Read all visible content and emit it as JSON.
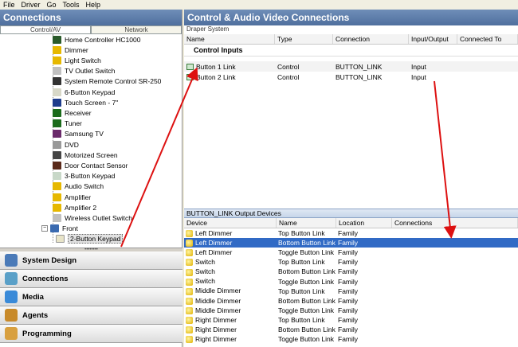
{
  "menu": [
    "File",
    "Driver",
    "Go",
    "Tools",
    "Help"
  ],
  "left": {
    "title": "Connections",
    "tabs": [
      "Control/AV",
      "Network"
    ],
    "tree": [
      {
        "label": "Home Controller HC1000",
        "color": "#2a5a2a"
      },
      {
        "label": "Dimmer",
        "color": "#e6b800"
      },
      {
        "label": "Light Switch",
        "color": "#e6b800"
      },
      {
        "label": "TV Outlet Switch",
        "color": "#c0c0c0"
      },
      {
        "label": "System Remote Control SR-250",
        "color": "#333333"
      },
      {
        "label": "6-Button Keypad",
        "color": "#d8d8c8"
      },
      {
        "label": "Touch Screen - 7\"",
        "color": "#1e3c8c"
      },
      {
        "label": "Receiver",
        "color": "#1b6b1b"
      },
      {
        "label": "Tuner",
        "color": "#1b6b1b"
      },
      {
        "label": "Samsung TV",
        "color": "#6a2a6a"
      },
      {
        "label": "DVD",
        "color": "#999999"
      },
      {
        "label": "Motorized Screen",
        "color": "#444444"
      },
      {
        "label": "Door Contact Sensor",
        "color": "#5a2a1a"
      },
      {
        "label": "3-Button Keypad",
        "color": "#c8d8c8"
      },
      {
        "label": "Audio Switch",
        "color": "#e6b800"
      },
      {
        "label": "Amplifier",
        "color": "#e6b800"
      },
      {
        "label": "Amplifier 2",
        "color": "#e6b800"
      },
      {
        "label": "Wireless Outlet Switch",
        "color": "#c0c0c0"
      }
    ],
    "front": "Front",
    "front_child": "2-Button Keypad",
    "nav": [
      {
        "label": "System Design",
        "color": "#4a7ab8"
      },
      {
        "label": "Connections",
        "color": "#5aa0c8"
      },
      {
        "label": "Media",
        "color": "#3a8ad8"
      },
      {
        "label": "Agents",
        "color": "#c88a2a"
      },
      {
        "label": "Programming",
        "color": "#d8a040"
      }
    ]
  },
  "right": {
    "title": "Control & Audio Video Connections",
    "subtitle": "Draper System",
    "columns": [
      "Name",
      "Type",
      "Connection",
      "Input/Output",
      "Connected To"
    ],
    "group": "Control Inputs",
    "rows": [
      {
        "name": "Button 1 Link",
        "type": "Control",
        "connection": "BUTTON_LINK",
        "io": "Input",
        "to": ""
      },
      {
        "name": "Button 2 Link",
        "type": "Control",
        "connection": "BUTTON_LINK",
        "io": "Input",
        "to": ""
      }
    ],
    "output_title": "BUTTON_LINK Output Devices",
    "output_columns": [
      "Device",
      "Name",
      "Location",
      "Connections"
    ],
    "output_rows": [
      {
        "device": "Left Dimmer",
        "name": "Top Button Link",
        "location": "Family",
        "selected": false
      },
      {
        "device": "Left Dimmer",
        "name": "Bottom Button Link",
        "location": "Family",
        "selected": true
      },
      {
        "device": "Left Dimmer",
        "name": "Toggle Button Link",
        "location": "Family",
        "selected": false
      },
      {
        "device": "Switch",
        "name": "Top Button Link",
        "location": "Family",
        "selected": false
      },
      {
        "device": "Switch",
        "name": "Bottom Button Link",
        "location": "Family",
        "selected": false
      },
      {
        "device": "Switch",
        "name": "Toggle Button Link",
        "location": "Family",
        "selected": false
      },
      {
        "device": "Middle Dimmer",
        "name": "Top Button Link",
        "location": "Family",
        "selected": false
      },
      {
        "device": "Middle Dimmer",
        "name": "Bottom Button Link",
        "location": "Family",
        "selected": false
      },
      {
        "device": "Middle Dimmer",
        "name": "Toggle Button Link",
        "location": "Family",
        "selected": false
      },
      {
        "device": "Right Dimmer",
        "name": "Top Button Link",
        "location": "Family",
        "selected": false
      },
      {
        "device": "Right Dimmer",
        "name": "Bottom Button Link",
        "location": "Family",
        "selected": false
      },
      {
        "device": "Right Dimmer",
        "name": "Toggle Button Link",
        "location": "Family",
        "selected": false
      }
    ]
  },
  "colors": {
    "arrow": "#dd1111",
    "selection": "#316ac5",
    "title_bar": "#5a7aa8"
  }
}
